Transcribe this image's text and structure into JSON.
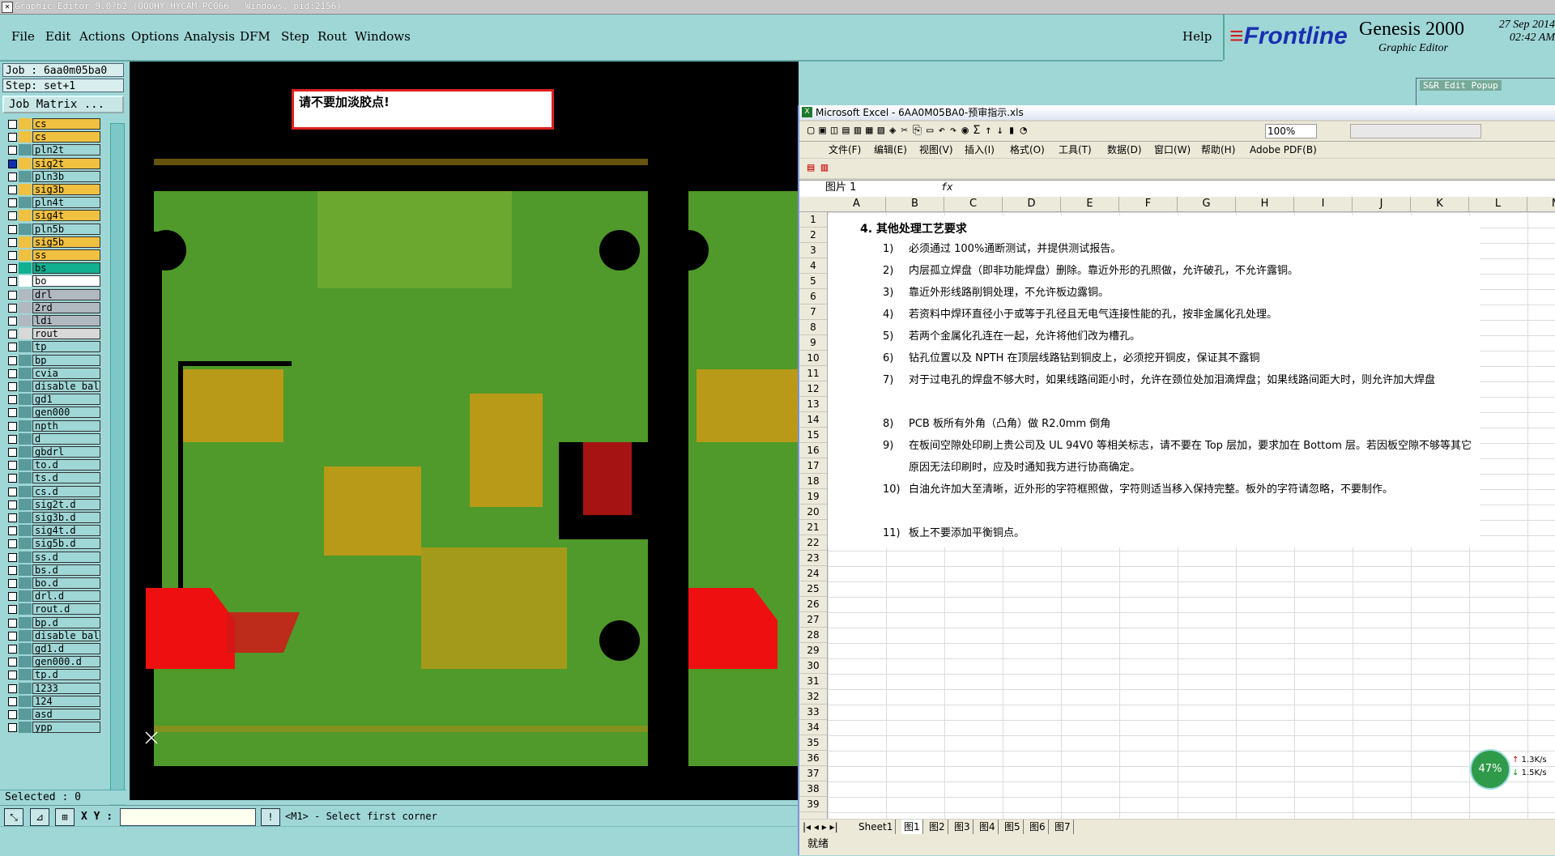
{
  "window": {
    "title": "Graphic Editor 9.0?b2 (OOOHY-HYCAM-PC066 - Windows, pid:2156)"
  },
  "menu": [
    "File",
    "Edit",
    "Actions",
    "Options",
    "Analysis",
    "DFM",
    "Step",
    "Rout",
    "Windows"
  ],
  "help": "Help",
  "brand": {
    "frontline": "Frontline",
    "product": "Genesis 2000",
    "subtitle": "Graphic Editor",
    "date": "27 Sep 2014",
    "time": "02:42 AM"
  },
  "job": {
    "label": "Job : 6aa0m05ba0",
    "step": "Step: set+1",
    "matrix_button": "Job Matrix ..."
  },
  "layers": [
    {
      "name": "cs",
      "color": "#f0c040",
      "on": false
    },
    {
      "name": "cs",
      "color": "#f0c040",
      "on": false
    },
    {
      "name": "pln2t",
      "color": "#9fd6d6",
      "on": false
    },
    {
      "name": "sig2t",
      "color": "#f0c040",
      "on": true
    },
    {
      "name": "pln3b",
      "color": "#9fd6d6",
      "on": false
    },
    {
      "name": "sig3b",
      "color": "#f0c040",
      "on": false
    },
    {
      "name": "pln4t",
      "color": "#9fd6d6",
      "on": false
    },
    {
      "name": "sig4t",
      "color": "#f0c040",
      "on": false
    },
    {
      "name": "pln5b",
      "color": "#9fd6d6",
      "on": false
    },
    {
      "name": "sig5b",
      "color": "#f0c040",
      "on": false
    },
    {
      "name": "ss",
      "color": "#f0c040",
      "on": false
    },
    {
      "name": "bs",
      "color": "#10b090",
      "on": false
    },
    {
      "name": "bo",
      "color": "#ffffff",
      "on": false
    },
    {
      "name": "drl",
      "color": "#b0b8c0",
      "on": false
    },
    {
      "name": "2rd",
      "color": "#b0b8c0",
      "on": false
    },
    {
      "name": "ldi",
      "color": "#b0b8c0",
      "on": false
    },
    {
      "name": "rout",
      "color": "#d8d8d8",
      "on": false
    },
    {
      "name": "tp",
      "color": "#9fd6d6",
      "on": false
    },
    {
      "name": "bp",
      "color": "#9fd6d6",
      "on": false
    },
    {
      "name": "cvia",
      "color": "#9fd6d6",
      "on": false
    },
    {
      "name": "disable_bal",
      "color": "#9fd6d6",
      "on": false
    },
    {
      "name": "gd1",
      "color": "#9fd6d6",
      "on": false
    },
    {
      "name": "gen000",
      "color": "#9fd6d6",
      "on": false
    },
    {
      "name": "npth",
      "color": "#9fd6d6",
      "on": false
    },
    {
      "name": "d",
      "color": "#9fd6d6",
      "on": false
    },
    {
      "name": "gbdrl",
      "color": "#9fd6d6",
      "on": false
    },
    {
      "name": "to.d",
      "color": "#9fd6d6",
      "on": false
    },
    {
      "name": "ts.d",
      "color": "#9fd6d6",
      "on": false
    },
    {
      "name": "cs.d",
      "color": "#9fd6d6",
      "on": false
    },
    {
      "name": "sig2t.d",
      "color": "#9fd6d6",
      "on": false
    },
    {
      "name": "sig3b.d",
      "color": "#9fd6d6",
      "on": false
    },
    {
      "name": "sig4t.d",
      "color": "#9fd6d6",
      "on": false
    },
    {
      "name": "sig5b.d",
      "color": "#9fd6d6",
      "on": false
    },
    {
      "name": "ss.d",
      "color": "#9fd6d6",
      "on": false
    },
    {
      "name": "bs.d",
      "color": "#9fd6d6",
      "on": false
    },
    {
      "name": "bo.d",
      "color": "#9fd6d6",
      "on": false
    },
    {
      "name": "drl.d",
      "color": "#9fd6d6",
      "on": false
    },
    {
      "name": "rout.d",
      "color": "#9fd6d6",
      "on": false
    },
    {
      "name": "bp.d",
      "color": "#9fd6d6",
      "on": false
    },
    {
      "name": "disable_bal",
      "color": "#9fd6d6",
      "on": false
    },
    {
      "name": "gd1.d",
      "color": "#9fd6d6",
      "on": false
    },
    {
      "name": "gen000.d",
      "color": "#9fd6d6",
      "on": false
    },
    {
      "name": "tp.d",
      "color": "#9fd6d6",
      "on": false
    },
    {
      "name": "1233",
      "color": "#9fd6d6",
      "on": false
    },
    {
      "name": "124",
      "color": "#9fd6d6",
      "on": false
    },
    {
      "name": "asd",
      "color": "#9fd6d6",
      "on": false
    },
    {
      "name": "ypp",
      "color": "#9fd6d6",
      "on": false
    }
  ],
  "selected": "Selected : 0",
  "xy_label": "X Y :",
  "status_msg": "<M1> - Select first corner",
  "canvas_notice": "请不要加淡胶点!",
  "excel": {
    "title": "Microsoft Excel - 6AA0M05BA0-预审指示.xls",
    "zoom": "100%",
    "menu": [
      "文件(F)",
      "编辑(E)",
      "视图(V)",
      "插入(I)",
      "格式(O)",
      "工具(T)",
      "数据(D)",
      "窗口(W)",
      "帮助(H)",
      "Adobe PDF(B)"
    ],
    "namebox": "图片 1",
    "fx": "fx",
    "columns": [
      "A",
      "B",
      "C",
      "D",
      "E",
      "F",
      "G",
      "H",
      "I",
      "J",
      "K",
      "L",
      "M"
    ],
    "rows": [
      "1",
      "2",
      "3",
      "4",
      "5",
      "6",
      "7",
      "8",
      "9",
      "10",
      "11",
      "12",
      "13",
      "14",
      "15",
      "16",
      "17",
      "18",
      "19",
      "20",
      "21",
      "22",
      "23",
      "24",
      "25",
      "26",
      "27",
      "28",
      "29",
      "30",
      "31",
      "32",
      "33",
      "34",
      "35",
      "36",
      "37",
      "38",
      "39"
    ],
    "heading": "4.  其他处理工艺要求",
    "requirements": [
      {
        "num": "1)",
        "text": "必须通过 100%通断测试，并提供测试报告。"
      },
      {
        "num": "2)",
        "text": "内层孤立焊盘（即非功能焊盘）删除。靠近外形的孔照做，允许破孔，不允许露铜。"
      },
      {
        "num": "3)",
        "text": "靠近外形线路削铜处理，不允许板边露铜。"
      },
      {
        "num": "4)",
        "text": "若资料中焊环直径小于或等于孔径且无电气连接性能的孔，按非金属化孔处理。"
      },
      {
        "num": "5)",
        "text": "若两个金属化孔连在一起，允许将他们改为槽孔。"
      },
      {
        "num": "6)",
        "text": "钻孔位置以及 NPTH 在顶层线路钻到铜皮上，必须挖开铜皮，保证其不露铜"
      },
      {
        "num": "7)",
        "text": "对于过电孔的焊盘不够大时，如果线路间距小时，允许在颈位处加泪滴焊盘；如果线路间距大时，则允许加大焊盘"
      },
      {
        "num": "8)",
        "text": "PCB 板所有外角（凸角）做 R2.0mm 倒角"
      },
      {
        "num": "9)",
        "text": "在板间空隙处印刷上贵公司及 UL 94V0 等相关标志，请不要在 Top 层加，要求加在 Bottom 层。若因板空隙不够等其它原因无法印刷时，应及时通知我方进行协商确定。"
      },
      {
        "num": "10)",
        "text": "白油允许加大至清晰，近外形的字符框照做，字符则适当移入保持完整。板外的字符请忽略，不要制作。"
      },
      {
        "num": "11)",
        "text": "板上不要添加平衡铜点。"
      }
    ],
    "sheets": [
      "Sheet1",
      "图1",
      "图2",
      "图3",
      "图4",
      "图5",
      "图6",
      "图7"
    ],
    "status": "就绪"
  },
  "sar_popup": "S&R Edit Popup",
  "net": {
    "percent": "47%",
    "up": "1.3K/s",
    "down": "1.5K/s"
  }
}
